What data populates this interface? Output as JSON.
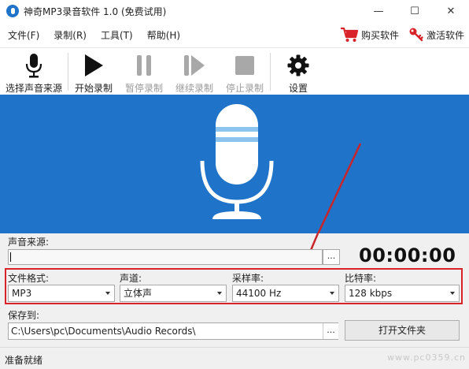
{
  "window": {
    "title": "神奇MP3录音软件 1.0 (免费试用)",
    "minimize": "—",
    "maximize": "☐",
    "close": "✕"
  },
  "menu": {
    "items": [
      "文件(F)",
      "录制(R)",
      "工具(T)",
      "帮助(H)"
    ],
    "buy": "购买软件",
    "activate": "激活软件"
  },
  "toolbar": {
    "select_source": "选择声音来源",
    "start": "开始录制",
    "pause": "暂停录制",
    "resume": "继续录制",
    "stop": "停止录制",
    "settings": "设置"
  },
  "source": {
    "label": "声音来源:",
    "value": "",
    "browse": "..."
  },
  "timer": "00:00:00",
  "params": {
    "format": {
      "label": "文件格式:",
      "value": "MP3"
    },
    "channel": {
      "label": "声道:",
      "value": "立体声"
    },
    "samplerate": {
      "label": "采样率:",
      "value": "44100 Hz"
    },
    "bitrate": {
      "label": "比特率:",
      "value": "128 kbps"
    }
  },
  "save": {
    "label": "保存到:",
    "path": "C:\\Users\\pc\\Documents\\Audio Records\\",
    "browse": "...",
    "open_folder": "打开文件夹"
  },
  "status": "准备就绪",
  "watermark": "www.pc0359.cn",
  "colors": {
    "banner": "#1f74c9",
    "highlight_box": "#d8232a",
    "arrow": "#c8252b",
    "buy_icon": "#d8232a",
    "activate_icon": "#d8232a"
  }
}
